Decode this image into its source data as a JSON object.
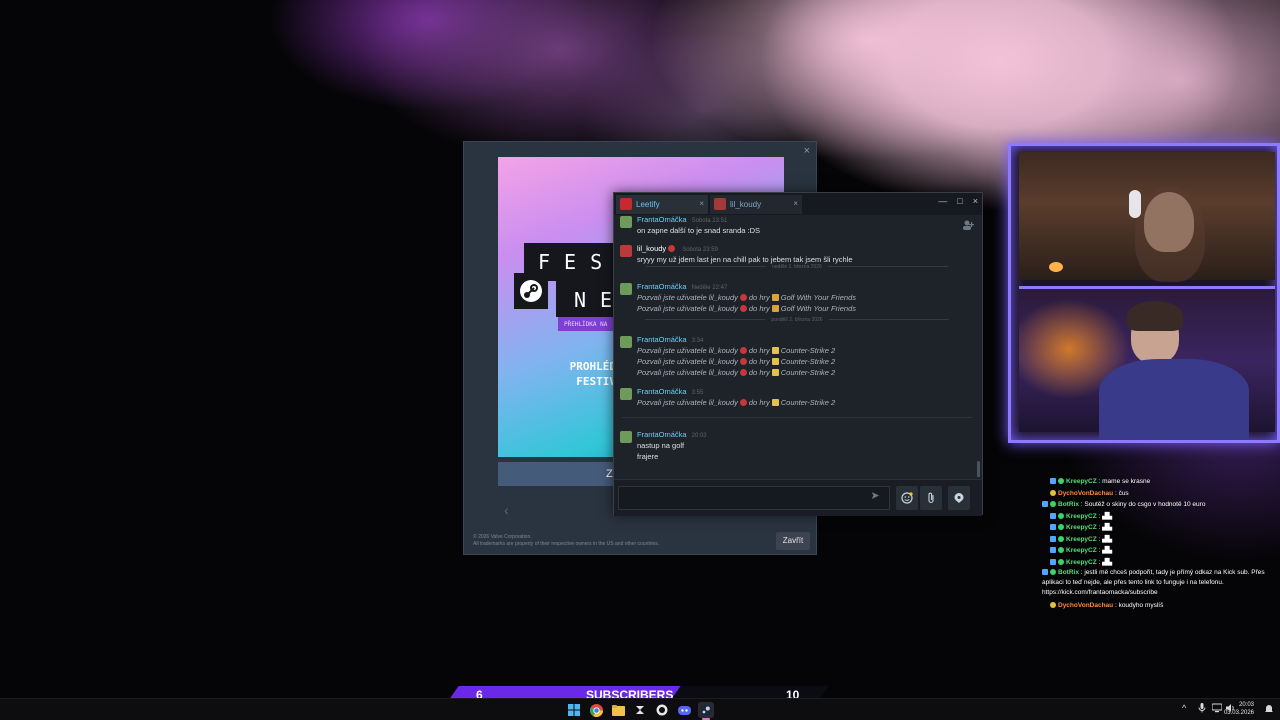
{
  "sale_popup": {
    "close_glyph": "×",
    "banner_line1": "FES",
    "banner_line2": "NE",
    "banner_strip": "PŘEHLÍDKA NA",
    "banner_text_line1": "PROHLÉDNĚTE SI",
    "banner_text_line2": "FESTIVALU ST",
    "cta_label": "Z",
    "footer_line1": "© 2026 Valve Corporation.",
    "footer_line2": "All trademarks are property of their respective owners in the US and other countries.",
    "close_button": "Zavřít"
  },
  "chat": {
    "tabs": [
      {
        "label": "Leetify"
      },
      {
        "label": "lil_koudy"
      }
    ],
    "window_controls": [
      "—",
      "□",
      "×"
    ],
    "messages": [
      {
        "name": "FrantaOmáčka",
        "time": "Sobota 23:51",
        "lines": [
          "on zapne další to je snad sranda :DS"
        ]
      },
      {
        "name": "lil_koudy",
        "time": "Sobota 23:59",
        "lines": [
          "sryyy my už jdem last jen na chill pak to jebem tak jsem šli rychle"
        ]
      },
      {
        "name": "FrantaOmáčka",
        "time": "Neděle 22:47",
        "invite_user": "Pozvali jste uživatele lil_koudy",
        "invite_mid": "do hry",
        "game": "Golf With Your Friends",
        "count": 2
      },
      {
        "name": "FrantaOmáčka",
        "time": "3:34",
        "invite_user": "Pozvali jste uživatele lil_koudy",
        "invite_mid": "do hry",
        "game": "Counter-Strike 2",
        "count": 3
      },
      {
        "name": "FrantaOmáčka",
        "time": "3:55",
        "invite_user": "Pozvali jste uživatele lil_koudy",
        "invite_mid": "do hry",
        "game": "Counter-Strike 2",
        "count": 1
      },
      {
        "name": "FrantaOmáčka",
        "time": "20:03",
        "lines": [
          "nastup na golf",
          "frajere"
        ]
      }
    ],
    "dividers": [
      "neděle 1. března 2026",
      "pondělí 2. března 2026"
    ],
    "send_glyph": "➤"
  },
  "stream_chat": [
    {
      "user": "KreepyCZ",
      "text": ": mame se krasne",
      "kind": "kreepy"
    },
    {
      "user": "DychoVonDachau",
      "text": ": čus",
      "kind": "dycho"
    },
    {
      "user": "BotRix",
      "text": ": Soutěž o skiny do csgo v hodnotě 10 euro",
      "kind": "bot"
    },
    {
      "user": "KreepyCZ",
      "text": ":",
      "kind": "kreepy"
    },
    {
      "user": "KreepyCZ",
      "text": ":",
      "kind": "kreepy"
    },
    {
      "user": "KreepyCZ",
      "text": ":",
      "kind": "kreepy"
    },
    {
      "user": "KreepyCZ",
      "text": ":",
      "kind": "kreepy"
    },
    {
      "user": "KreepyCZ",
      "text": ":",
      "kind": "kreepy"
    },
    {
      "user": "BotRix",
      "text": ": jestli mě chceš podpořit, tady je přímý odkaz na Kick sub. Přes aplikaci to teď nejde, ale přes tento link to funguje i na telefonu. https://kick.com/frantaomacka/subscribe",
      "kind": "bot"
    },
    {
      "user": "DychoVonDachau",
      "text": ": koudyho myslíš",
      "kind": "dycho"
    }
  ],
  "subscribers": {
    "current": "6",
    "label": "SUBSCRIBERS",
    "goal": "10",
    "progress": 0.6
  },
  "taskbar": {
    "time": "20:03",
    "date": "03.03.2026",
    "tray_chevron": "^"
  },
  "colors": {
    "accent_purple": "#6a28e8",
    "steam_link": "#6dcff6",
    "cam_border": "#8d7bff"
  }
}
